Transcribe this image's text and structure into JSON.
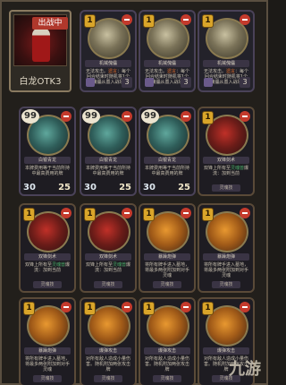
{
  "hero": {
    "status_tag": "出战中",
    "name": "白龙OTK3"
  },
  "row1": [
    {
      "cost": "1",
      "name": "机械傀儡",
      "desc_a": "无法攻击。",
      "desc_hl": "遗言",
      "desc_b": "：每个回合结束时随机将1个傀儡从置入战场",
      "stat": "3"
    },
    {
      "cost": "1",
      "name": "机械傀儡",
      "desc_a": "无法攻击。",
      "desc_hl": "遗言",
      "desc_b": "：每个回合结束时随机将1个傀儡从置入战场",
      "stat": "3"
    },
    {
      "cost": "1",
      "name": "机械傀儡",
      "desc_a": "无法攻击。",
      "desc_hl": "遗言",
      "desc_b": "：每个回合结束时随机将1个傀儡从置入战场",
      "stat": "3"
    }
  ],
  "row2": [
    {
      "cost": "99",
      "name": "白银青龙",
      "desc": "本牌费用等于当前所持中最高费用的牌",
      "atk": "30",
      "hp": "25"
    },
    {
      "cost": "99",
      "name": "白银青龙",
      "desc": "本牌费用等于当前所持中最高费用的牌",
      "atk": "30",
      "hp": "25"
    },
    {
      "cost": "99",
      "name": "白银青龙",
      "desc": "本牌费用等于当前所持中最高费用的牌",
      "atk": "30",
      "hp": "25"
    },
    {
      "cost": "1",
      "name": "双锋剑术",
      "desc_a": "双锋上所有至",
      "desc_hl": "灵魂兽",
      "desc_b": "爆流：加到当前",
      "footer": "灵魂技"
    }
  ],
  "row3": [
    {
      "cost": "1",
      "name": "双锋剑术",
      "desc_a": "双锋上所有至",
      "desc_hl": "灵魂兽",
      "desc_b": "爆流：加到当前",
      "footer": "灵魂技"
    },
    {
      "cost": "1",
      "name": "双锋剑术",
      "desc_a": "双锋上所有至",
      "desc_hl": "灵魂兽",
      "desc_b": "爆流：加到当前",
      "footer": "灵魂技"
    },
    {
      "cost": "1",
      "name": "暴躁炮弹",
      "desc": "将所有牌手进入墓地，将最多两张附加到对手灵魂",
      "footer": "灵魂技"
    },
    {
      "cost": "1",
      "name": "暴躁炮弹",
      "desc": "将所有牌手进入墓地，将最多两张附加到对手灵魂",
      "footer": "灵魂技"
    }
  ],
  "row4": [
    {
      "cost": "1",
      "name": "暴躁炮弹",
      "desc": "将所有牌手进入墓地，将最多两张附加到对手灵魂",
      "footer": "灵魂技"
    },
    {
      "cost": "1",
      "name": "爆弹攻击",
      "desc": "对所有敌人造成小量伤害。随机附加两张攻击牌",
      "footer": "灵魂技"
    },
    {
      "cost": "1",
      "name": "爆弹攻击",
      "desc": "对所有敌人造成小量伤害。随机附加两张攻击牌",
      "footer": "灵魂技"
    },
    {
      "cost": "1",
      "name": "爆弹攻击",
      "desc": "对所有敌人造成小量伤害。随机附加两张攻击牌",
      "footer": "灵魂技"
    }
  ],
  "watermark": "九游"
}
